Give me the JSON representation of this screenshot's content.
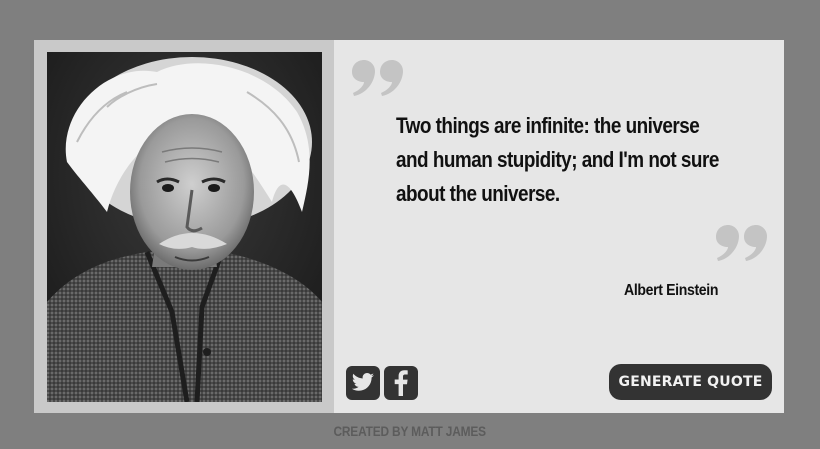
{
  "quote": {
    "text": "Two things are infinite: the universe and human stupidity; and I'm not sure about the universe.",
    "author": "Albert Einstein"
  },
  "portrait": {
    "subject": "Albert Einstein",
    "style": "black-and-white photograph"
  },
  "actions": {
    "generate_label": "GENERATE QUOTE",
    "social": [
      {
        "name": "twitter",
        "icon": "twitter-icon"
      },
      {
        "name": "facebook",
        "icon": "facebook-icon"
      }
    ]
  },
  "footer": {
    "credit": "CREATED BY MATT JAMES"
  },
  "colors": {
    "page_background": "#7f7f7f",
    "card_background": "#e6e6e6",
    "photo_frame": "#c9c9c9",
    "button_background": "#333333",
    "quote_mark": "#c4c4c4",
    "footer_text": "#5c5c5c"
  }
}
